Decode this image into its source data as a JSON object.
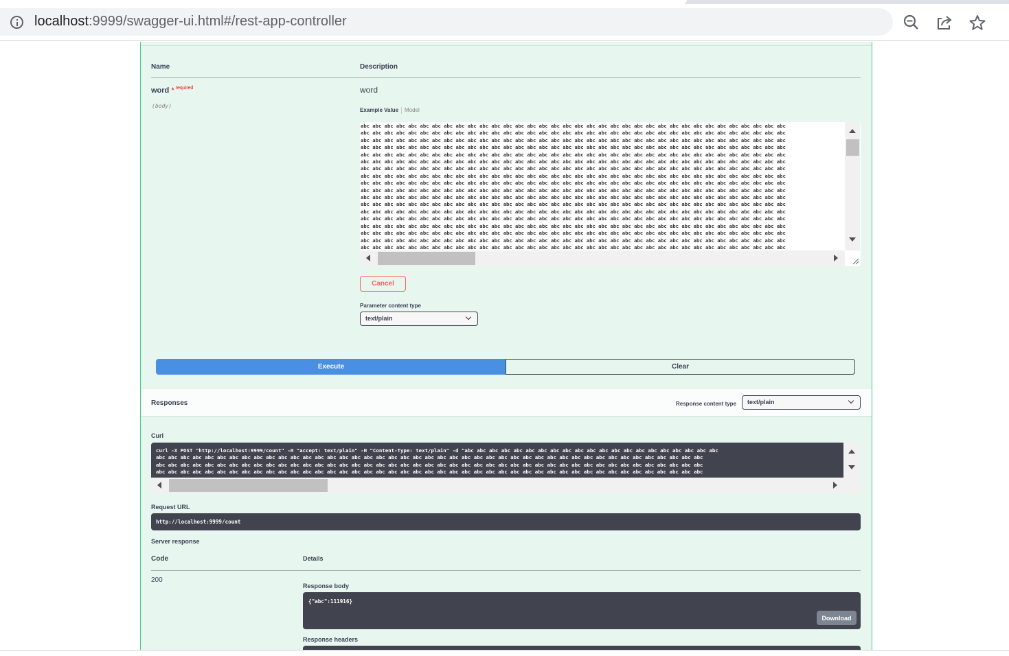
{
  "browser": {
    "url_host": "localhost",
    "url_path": ":9999/swagger-ui.html#/rest-app-controller"
  },
  "params": {
    "header_name": "Name",
    "header_description": "Description",
    "param_name": "word",
    "required_star": "*",
    "required_label": "required",
    "param_in": "(body)",
    "param_description": "word",
    "tab_example": "Example Value",
    "tab_model": "Model",
    "example_token": "abc",
    "cancel_label": "Cancel",
    "content_type_label": "Parameter content type",
    "content_type_value": "text/plain"
  },
  "actions": {
    "execute_label": "Execute",
    "clear_label": "Clear"
  },
  "responses": {
    "title": "Responses",
    "content_type_label": "Response content type",
    "content_type_value": "text/plain",
    "curl_label": "Curl",
    "curl_first_line": "curl -X POST \"http://localhost:9999/count\" -H \"accept: text/plain\" -H \"Content-Type: text/plain\" -d \"abc abc abc abc abc abc abc abc abc abc abc abc abc abc abc abc abc abc abc abc abc",
    "request_url_label": "Request URL",
    "request_url": "http://localhost:9999/count",
    "server_response_label": "Server response",
    "code_header": "Code",
    "details_header": "Details",
    "code": "200",
    "response_body_label": "Response body",
    "response_body": "{\"abc\":111916}",
    "download_label": "Download",
    "response_headers_label": "Response headers"
  }
}
